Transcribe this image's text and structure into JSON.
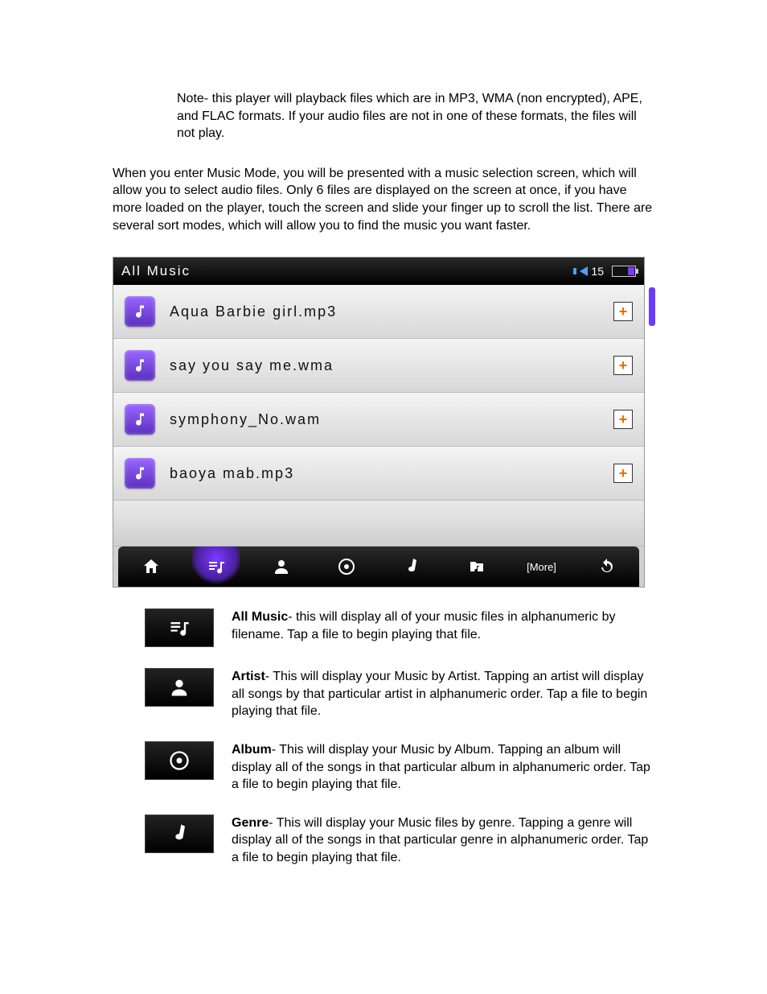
{
  "note": "Note- this player will playback files which are in MP3, WMA (non encrypted), APE, and FLAC formats. If your audio files are not in one of these formats, the files will not play.",
  "intro": " When you enter Music Mode, you will be presented with a music selection screen, which will allow you to select audio files. Only 6 files are displayed on the screen at once, if you have more loaded on the player, touch the screen and slide your finger up to scroll the list. There are several sort modes, which will allow you to find the music you want faster.",
  "device": {
    "title": "All Music",
    "volume": "15",
    "songs": [
      "Aqua Barbie girl.mp3",
      "say you say me.wma",
      "symphony_No.wam",
      "baoya mab.mp3"
    ],
    "more_label": "[More]"
  },
  "legend": [
    {
      "title": "All Music",
      "desc": "- this will display all of your music files in alphanumeric by filename. Tap a file to begin playing that file."
    },
    {
      "title": "Artist",
      "desc": "- This will display your Music by Artist. Tapping an artist will display all songs by that particular artist in alphanumeric order. Tap a file to begin playing that file."
    },
    {
      "title": "Album",
      "desc": "- This will display your Music by Album. Tapping an album will display all of the songs in that particular album in alphanumeric order. Tap a file to begin playing that file."
    },
    {
      "title": "Genre",
      "desc": "- This will display your Music files by genre. Tapping a genre will display all of the songs in that particular genre in alphanumeric order. Tap a file to begin playing that file."
    }
  ]
}
